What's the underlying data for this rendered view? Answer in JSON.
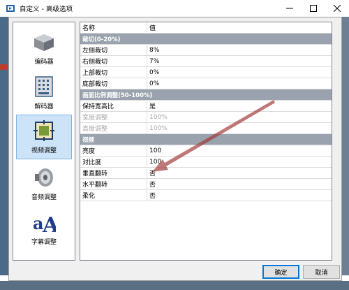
{
  "window": {
    "title": "自定义 - 高级选项",
    "controls": {
      "minimize": "minimize-icon",
      "maximize": "maximize-icon",
      "close": "close-icon"
    }
  },
  "sidebar": {
    "items": [
      {
        "label": "编码器",
        "icon": "encoder-icon",
        "active": false
      },
      {
        "label": "解码器",
        "icon": "decoder-icon",
        "active": false
      },
      {
        "label": "视频调整",
        "icon": "video-adjust-icon",
        "active": true
      },
      {
        "label": "音频调整",
        "icon": "audio-adjust-icon",
        "active": false
      },
      {
        "label": "字幕调整",
        "icon": "subtitle-adjust-icon",
        "active": false
      }
    ]
  },
  "grid": {
    "columns": [
      "名称",
      "值"
    ],
    "sections": [
      {
        "title": "裁切(0-20%)",
        "rows": [
          {
            "name": "左侧裁切",
            "value": "8%",
            "disabled": false
          },
          {
            "name": "右侧裁切",
            "value": "7%",
            "disabled": false
          },
          {
            "name": "上部裁切",
            "value": "0%",
            "disabled": false
          },
          {
            "name": "底部裁切",
            "value": "0%",
            "disabled": false
          }
        ]
      },
      {
        "title": "画面比例调整(50-100%)",
        "rows": [
          {
            "name": "保持宽高比",
            "value": "是",
            "disabled": false
          },
          {
            "name": "宽度调整",
            "value": "100%",
            "disabled": true
          },
          {
            "name": "高度调整",
            "value": "100%",
            "disabled": true
          }
        ]
      },
      {
        "title": "视频",
        "rows": [
          {
            "name": "亮度",
            "value": "100",
            "disabled": false
          },
          {
            "name": "对比度",
            "value": "100",
            "disabled": false
          },
          {
            "name": "垂直翻转",
            "value": "否",
            "disabled": false
          },
          {
            "name": "水平翻转",
            "value": "否",
            "disabled": false
          },
          {
            "name": "柔化",
            "value": "否",
            "disabled": false
          }
        ]
      }
    ]
  },
  "buttons": {
    "ok": "确定",
    "cancel": "取消"
  },
  "colors": {
    "accent": "#0078d7",
    "category_bg": "#9aa3ad",
    "selected_bg": "#cde3f7",
    "arrow": "#8b1a1a"
  }
}
